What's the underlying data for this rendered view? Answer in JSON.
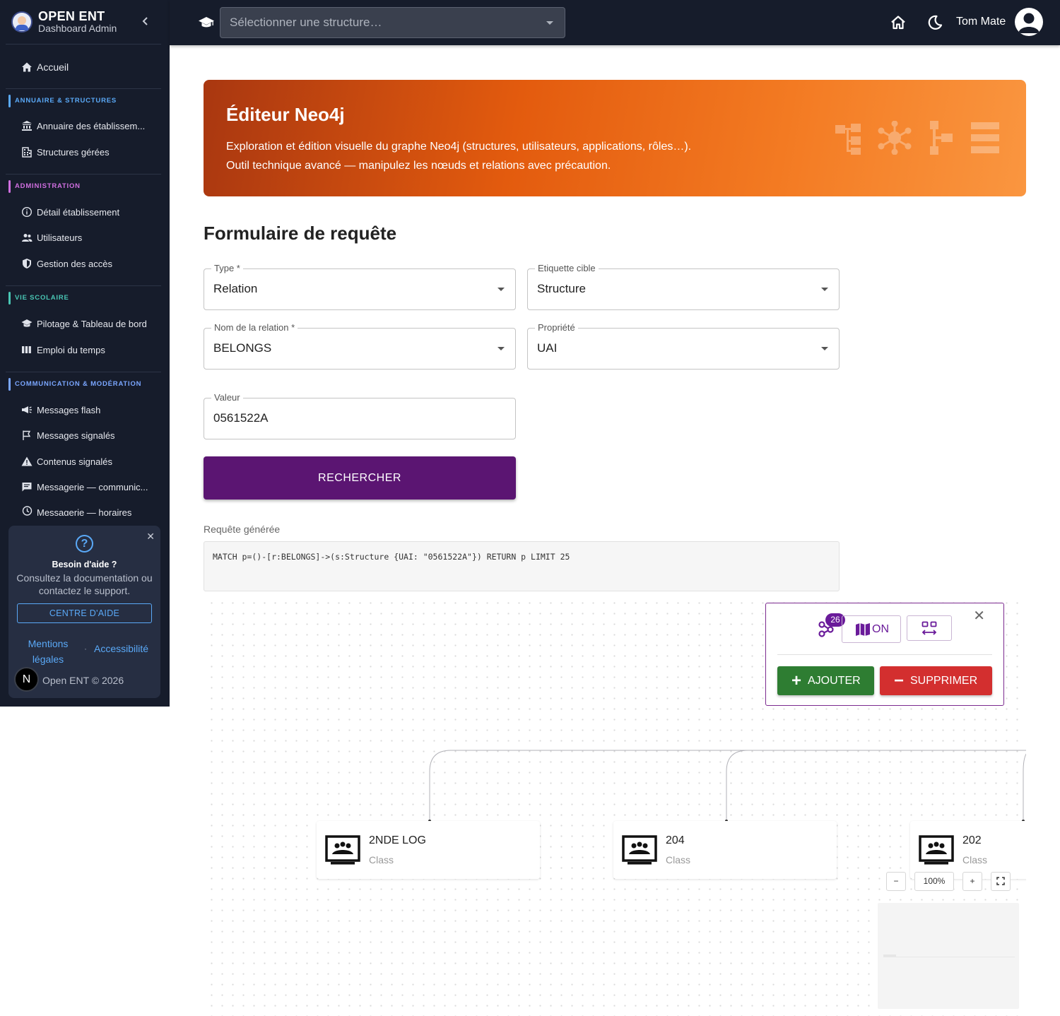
{
  "app": {
    "title": "OPEN ENT",
    "subtitle": "Dashboard Admin"
  },
  "sidebar": {
    "home": "Accueil",
    "sections": [
      {
        "title": "Annuaire & structures",
        "color": "#5aa9f7",
        "items": [
          "Annuaire des établissem...",
          "Structures gérées"
        ]
      },
      {
        "title": "Administration",
        "color": "#d06fe0",
        "items": [
          "Détail établissement",
          "Utilisateurs",
          "Gestion des accès"
        ]
      },
      {
        "title": "Vie scolaire",
        "color": "#49c6b4",
        "items": [
          "Pilotage & Tableau de bord",
          "Emploi du temps"
        ]
      },
      {
        "title": "Communication & modération",
        "color": "#7aa6ff",
        "items": [
          "Messages flash",
          "Messages signalés",
          "Contenus signalés",
          "Messagerie — communic...",
          "Messagerie — horaires"
        ]
      }
    ],
    "help": {
      "title": "Besoin d'aide ?",
      "text": "Consultez la documentation ou contactez le support.",
      "button": "CENTRE D'AIDE",
      "link_legal": "Mentions légales",
      "separator": "·",
      "link_access": "Accessibilité",
      "avatar_letter": "N",
      "copyright": "Open ENT © 2026"
    }
  },
  "topbar": {
    "structure_placeholder": "Sélectionner une structure…",
    "user_name": "Tom Mate"
  },
  "banner": {
    "title": "Éditeur Neo4j",
    "line1": "Exploration et édition visuelle du graphe Neo4j (structures, utilisateurs, applications, rôles…).",
    "line2": "Outil technique avancé — manipulez les nœuds et relations avec précaution."
  },
  "form": {
    "title": "Formulaire de requête",
    "type": {
      "label": "Type *",
      "value": "Relation"
    },
    "target": {
      "label": "Etiquette cible",
      "value": "Structure"
    },
    "relation": {
      "label": "Nom de la relation *",
      "value": "BELONGS"
    },
    "property": {
      "label": "Propriété",
      "value": "UAI"
    },
    "value": {
      "label": "Valeur",
      "value": "0561522A"
    },
    "search_button": "RECHERCHER",
    "query_label": "Requête générée",
    "query": "MATCH p=()-[r:BELONGS]->(s:Structure {UAI: \"0561522A\"}) RETURN p LIMIT 25"
  },
  "graph": {
    "nodes": [
      {
        "title": "2NDE LOG",
        "type": "Class"
      },
      {
        "title": "204",
        "type": "Class"
      },
      {
        "title": "202",
        "type": "Class"
      }
    ],
    "panel": {
      "count": "26",
      "toggle_label": "ON",
      "add_label": "AJOUTER",
      "delete_label": "SUPPRIMER"
    },
    "zoom": {
      "minus": "−",
      "level": "100%",
      "plus": "+"
    }
  },
  "colors": {
    "sidebar_bg": "#161c2b",
    "primary": "#5b1572",
    "add": "#2e7d32",
    "delete": "#d32f2f",
    "banner": "#e35b0e"
  }
}
